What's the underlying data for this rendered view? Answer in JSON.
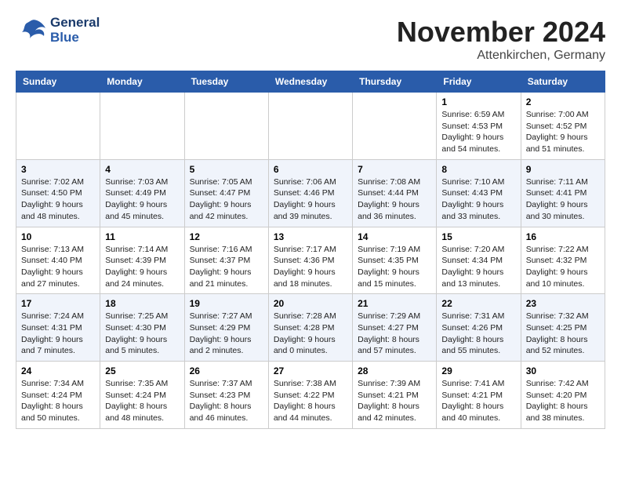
{
  "logo": {
    "line1": "General",
    "line2": "Blue"
  },
  "title": "November 2024",
  "location": "Attenkirchen, Germany",
  "headers": [
    "Sunday",
    "Monday",
    "Tuesday",
    "Wednesday",
    "Thursday",
    "Friday",
    "Saturday"
  ],
  "weeks": [
    [
      {
        "day": "",
        "sunrise": "",
        "sunset": "",
        "daylight": ""
      },
      {
        "day": "",
        "sunrise": "",
        "sunset": "",
        "daylight": ""
      },
      {
        "day": "",
        "sunrise": "",
        "sunset": "",
        "daylight": ""
      },
      {
        "day": "",
        "sunrise": "",
        "sunset": "",
        "daylight": ""
      },
      {
        "day": "",
        "sunrise": "",
        "sunset": "",
        "daylight": ""
      },
      {
        "day": "1",
        "sunrise": "Sunrise: 6:59 AM",
        "sunset": "Sunset: 4:53 PM",
        "daylight": "Daylight: 9 hours and 54 minutes."
      },
      {
        "day": "2",
        "sunrise": "Sunrise: 7:00 AM",
        "sunset": "Sunset: 4:52 PM",
        "daylight": "Daylight: 9 hours and 51 minutes."
      }
    ],
    [
      {
        "day": "3",
        "sunrise": "Sunrise: 7:02 AM",
        "sunset": "Sunset: 4:50 PM",
        "daylight": "Daylight: 9 hours and 48 minutes."
      },
      {
        "day": "4",
        "sunrise": "Sunrise: 7:03 AM",
        "sunset": "Sunset: 4:49 PM",
        "daylight": "Daylight: 9 hours and 45 minutes."
      },
      {
        "day": "5",
        "sunrise": "Sunrise: 7:05 AM",
        "sunset": "Sunset: 4:47 PM",
        "daylight": "Daylight: 9 hours and 42 minutes."
      },
      {
        "day": "6",
        "sunrise": "Sunrise: 7:06 AM",
        "sunset": "Sunset: 4:46 PM",
        "daylight": "Daylight: 9 hours and 39 minutes."
      },
      {
        "day": "7",
        "sunrise": "Sunrise: 7:08 AM",
        "sunset": "Sunset: 4:44 PM",
        "daylight": "Daylight: 9 hours and 36 minutes."
      },
      {
        "day": "8",
        "sunrise": "Sunrise: 7:10 AM",
        "sunset": "Sunset: 4:43 PM",
        "daylight": "Daylight: 9 hours and 33 minutes."
      },
      {
        "day": "9",
        "sunrise": "Sunrise: 7:11 AM",
        "sunset": "Sunset: 4:41 PM",
        "daylight": "Daylight: 9 hours and 30 minutes."
      }
    ],
    [
      {
        "day": "10",
        "sunrise": "Sunrise: 7:13 AM",
        "sunset": "Sunset: 4:40 PM",
        "daylight": "Daylight: 9 hours and 27 minutes."
      },
      {
        "day": "11",
        "sunrise": "Sunrise: 7:14 AM",
        "sunset": "Sunset: 4:39 PM",
        "daylight": "Daylight: 9 hours and 24 minutes."
      },
      {
        "day": "12",
        "sunrise": "Sunrise: 7:16 AM",
        "sunset": "Sunset: 4:37 PM",
        "daylight": "Daylight: 9 hours and 21 minutes."
      },
      {
        "day": "13",
        "sunrise": "Sunrise: 7:17 AM",
        "sunset": "Sunset: 4:36 PM",
        "daylight": "Daylight: 9 hours and 18 minutes."
      },
      {
        "day": "14",
        "sunrise": "Sunrise: 7:19 AM",
        "sunset": "Sunset: 4:35 PM",
        "daylight": "Daylight: 9 hours and 15 minutes."
      },
      {
        "day": "15",
        "sunrise": "Sunrise: 7:20 AM",
        "sunset": "Sunset: 4:34 PM",
        "daylight": "Daylight: 9 hours and 13 minutes."
      },
      {
        "day": "16",
        "sunrise": "Sunrise: 7:22 AM",
        "sunset": "Sunset: 4:32 PM",
        "daylight": "Daylight: 9 hours and 10 minutes."
      }
    ],
    [
      {
        "day": "17",
        "sunrise": "Sunrise: 7:24 AM",
        "sunset": "Sunset: 4:31 PM",
        "daylight": "Daylight: 9 hours and 7 minutes."
      },
      {
        "day": "18",
        "sunrise": "Sunrise: 7:25 AM",
        "sunset": "Sunset: 4:30 PM",
        "daylight": "Daylight: 9 hours and 5 minutes."
      },
      {
        "day": "19",
        "sunrise": "Sunrise: 7:27 AM",
        "sunset": "Sunset: 4:29 PM",
        "daylight": "Daylight: 9 hours and 2 minutes."
      },
      {
        "day": "20",
        "sunrise": "Sunrise: 7:28 AM",
        "sunset": "Sunset: 4:28 PM",
        "daylight": "Daylight: 9 hours and 0 minutes."
      },
      {
        "day": "21",
        "sunrise": "Sunrise: 7:29 AM",
        "sunset": "Sunset: 4:27 PM",
        "daylight": "Daylight: 8 hours and 57 minutes."
      },
      {
        "day": "22",
        "sunrise": "Sunrise: 7:31 AM",
        "sunset": "Sunset: 4:26 PM",
        "daylight": "Daylight: 8 hours and 55 minutes."
      },
      {
        "day": "23",
        "sunrise": "Sunrise: 7:32 AM",
        "sunset": "Sunset: 4:25 PM",
        "daylight": "Daylight: 8 hours and 52 minutes."
      }
    ],
    [
      {
        "day": "24",
        "sunrise": "Sunrise: 7:34 AM",
        "sunset": "Sunset: 4:24 PM",
        "daylight": "Daylight: 8 hours and 50 minutes."
      },
      {
        "day": "25",
        "sunrise": "Sunrise: 7:35 AM",
        "sunset": "Sunset: 4:24 PM",
        "daylight": "Daylight: 8 hours and 48 minutes."
      },
      {
        "day": "26",
        "sunrise": "Sunrise: 7:37 AM",
        "sunset": "Sunset: 4:23 PM",
        "daylight": "Daylight: 8 hours and 46 minutes."
      },
      {
        "day": "27",
        "sunrise": "Sunrise: 7:38 AM",
        "sunset": "Sunset: 4:22 PM",
        "daylight": "Daylight: 8 hours and 44 minutes."
      },
      {
        "day": "28",
        "sunrise": "Sunrise: 7:39 AM",
        "sunset": "Sunset: 4:21 PM",
        "daylight": "Daylight: 8 hours and 42 minutes."
      },
      {
        "day": "29",
        "sunrise": "Sunrise: 7:41 AM",
        "sunset": "Sunset: 4:21 PM",
        "daylight": "Daylight: 8 hours and 40 minutes."
      },
      {
        "day": "30",
        "sunrise": "Sunrise: 7:42 AM",
        "sunset": "Sunset: 4:20 PM",
        "daylight": "Daylight: 8 hours and 38 minutes."
      }
    ]
  ]
}
